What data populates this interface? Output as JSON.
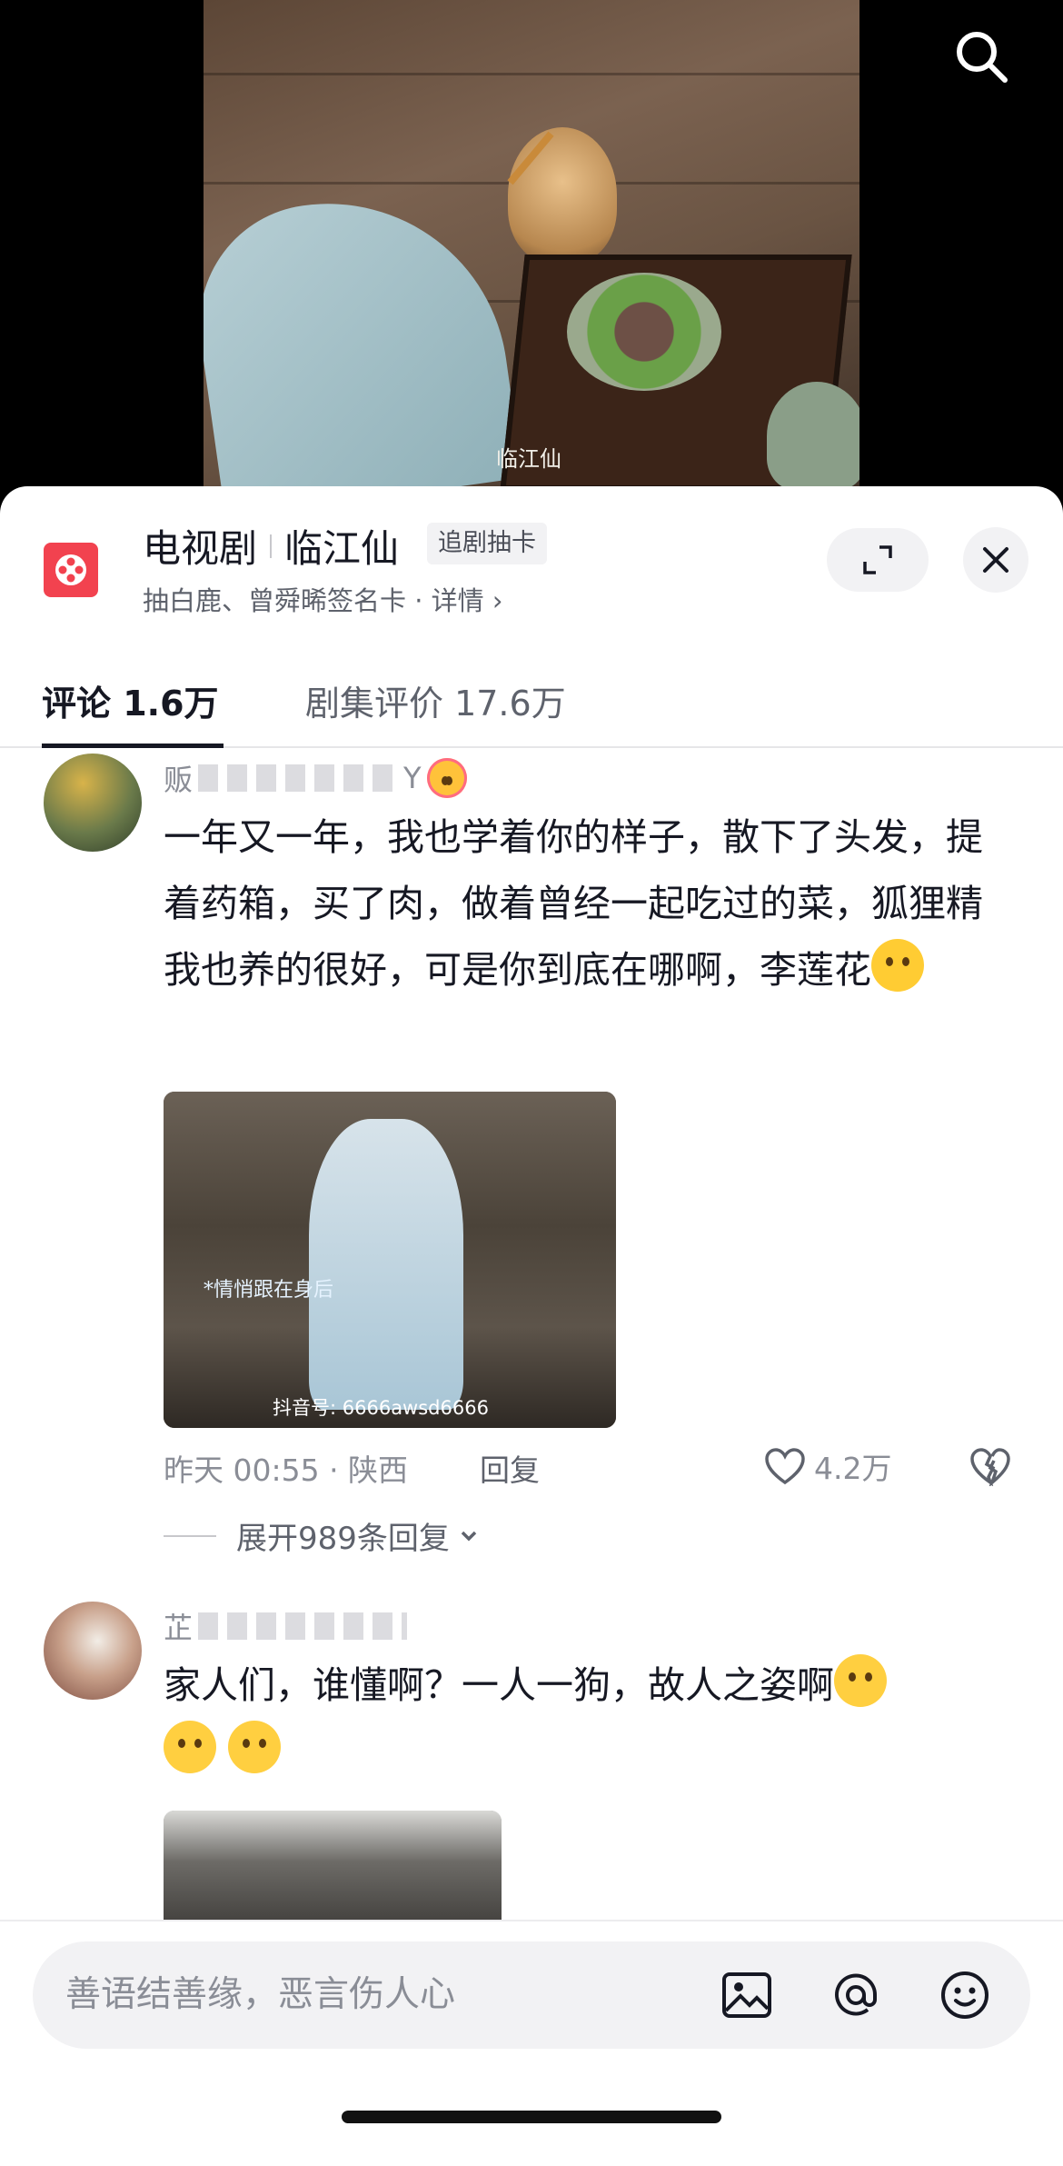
{
  "video": {
    "watermark": "临江仙",
    "search_icon": "search-icon"
  },
  "show": {
    "logo_icon": "film-reel-icon",
    "category": "电视剧",
    "title": "临江仙",
    "tag": "追剧抽卡",
    "subtitle": "抽白鹿、曾舜晞签名卡 · 详情 ›",
    "expand_icon": "expand-arrows-icon",
    "close_icon": "close-icon"
  },
  "tabs": [
    {
      "label": "评论 1.6万",
      "active": true
    },
    {
      "label": "剧集评价 17.6万",
      "active": false
    }
  ],
  "comments": [
    {
      "nickname_prefix": "贩",
      "nickname_suffix": "Y",
      "text": "一年又一年，我也学着你的样子，散下了头发，提着药箱，买了肉，做着曾经一起吃过的菜，狐狸精我也养的很好，可是你到底在哪啊，李莲花",
      "image_overlay": "*情悄跟在身后",
      "image_account": "抖音号: 6666awsd6666",
      "meta": "昨天 00:55 · 陕西",
      "reply_label": "回复",
      "likes": "4.2万",
      "expand_label": "展开989条回复"
    },
    {
      "nickname_prefix": "芷",
      "text": "家人们，谁懂啊？一人一狗，故人之姿啊"
    }
  ],
  "input": {
    "placeholder": "善语结善缘，恶言伤人心"
  }
}
